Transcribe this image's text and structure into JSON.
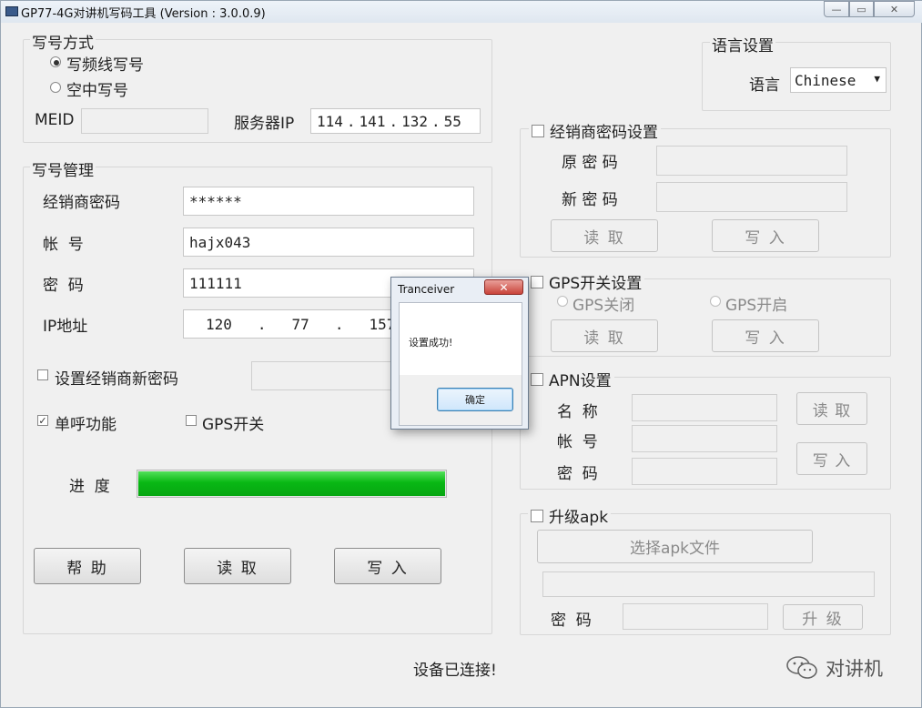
{
  "window": {
    "title": "GP77-4G对讲机写码工具 (Version : 3.0.0.9)",
    "caption_buttons": [
      "minimize-icon",
      "maximize-icon",
      "close-icon"
    ]
  },
  "write_mode": {
    "title": "写号方式",
    "options": [
      {
        "label": "写频线写号",
        "selected": true
      },
      {
        "label": "空中写号",
        "selected": false
      }
    ],
    "meid_label": "MEID",
    "meid_value": "",
    "server_ip_label": "服务器IP",
    "server_ip": [
      "114",
      "141",
      "132",
      "55"
    ]
  },
  "account_mgmt": {
    "title": "写号管理",
    "dealer_password_label": "经销商密码",
    "dealer_password_value": "******",
    "account_label": "帐  号",
    "account_value": "hajx043",
    "password_label": "密  码",
    "password_value": "111111",
    "ip_label": "IP地址",
    "ip_value": [
      "120",
      "77",
      "157"
    ],
    "set_dealer_pw_label": "设置经销商新密码",
    "set_dealer_pw_checked": false,
    "single_call_label": "单呼功能",
    "single_call_checked": true,
    "gps_switch_label": "GPS开关",
    "gps_switch_checked": false,
    "progress_label": "进  度",
    "progress_value": 1.0,
    "buttons": {
      "help": "帮  助",
      "read": "读  取",
      "write": "写  入"
    }
  },
  "language": {
    "title": "语言设置",
    "label": "语言",
    "selected": "Chinese"
  },
  "dealer_pw_settings": {
    "title": "经销商密码设置",
    "checked": false,
    "old_pw_label": "原 密 码",
    "new_pw_label": "新 密 码",
    "read": "读  取",
    "write": "写  入"
  },
  "gps_settings": {
    "title": "GPS开关设置",
    "checked": false,
    "off_label": "GPS关闭",
    "on_label": "GPS开启",
    "read": "读  取",
    "write": "写  入"
  },
  "apn_settings": {
    "title": "APN设置",
    "checked": false,
    "name_label": "名  称",
    "account_label": "帐  号",
    "password_label": "密  码",
    "read": "读  取",
    "write": "写  入"
  },
  "upgrade": {
    "title": "升级apk",
    "checked": false,
    "select_file": "选择apk文件",
    "password_label": "密  码",
    "upgrade_button": "升  级"
  },
  "status": "设备已连接!",
  "dialog": {
    "title": "Tranceiver",
    "close": "✕",
    "message": "设置成功!",
    "ok": "确定"
  },
  "watermark": "对讲机",
  "colors": {
    "progress": "#09b814",
    "dialog_close": "#c9433a"
  }
}
